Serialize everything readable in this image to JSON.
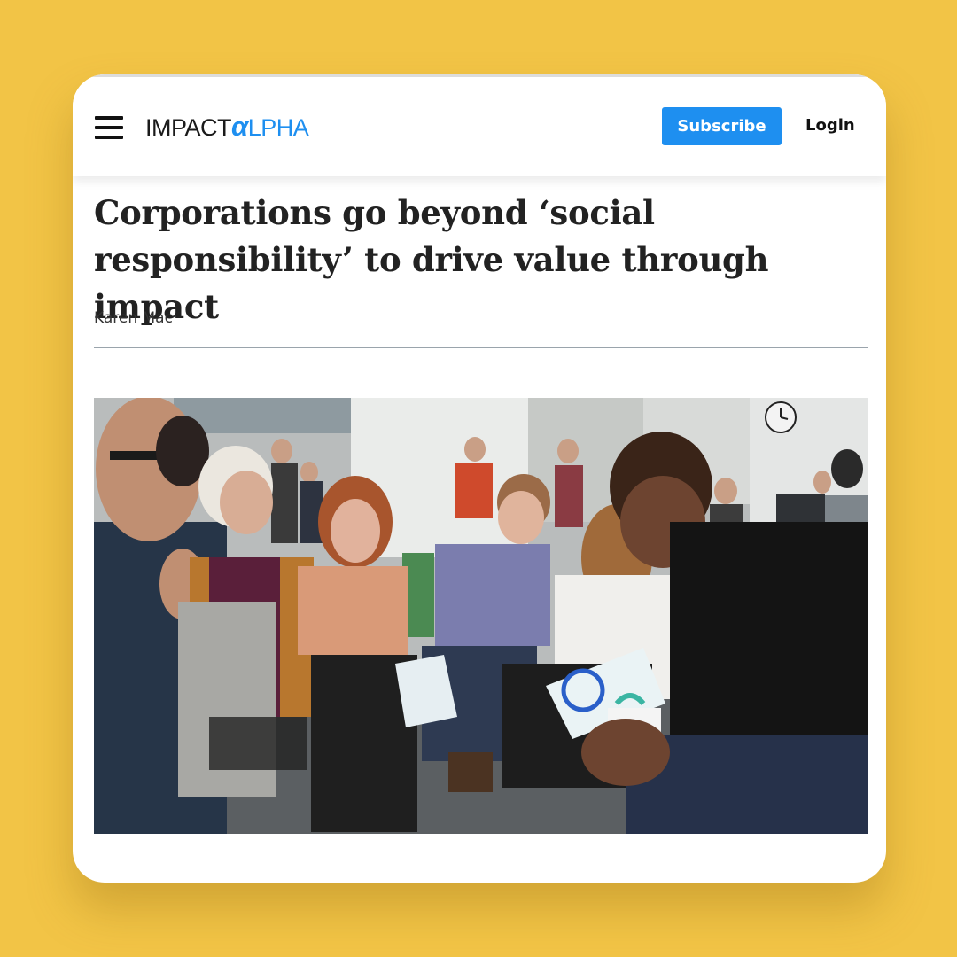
{
  "header": {
    "logo_impact": "IMPACT",
    "logo_alpha_mark": "α",
    "logo_alpha_rest": "LPHA",
    "subscribe_label": "Subscribe",
    "login_label": "Login"
  },
  "article": {
    "title": "Corporations go beyond ‘social responsibility’ to drive value through impact",
    "author": "Karen Mac"
  },
  "colors": {
    "background": "#F2C446",
    "brand_blue": "#1E8FF0"
  },
  "icons": [
    "hamburger-menu-icon"
  ]
}
